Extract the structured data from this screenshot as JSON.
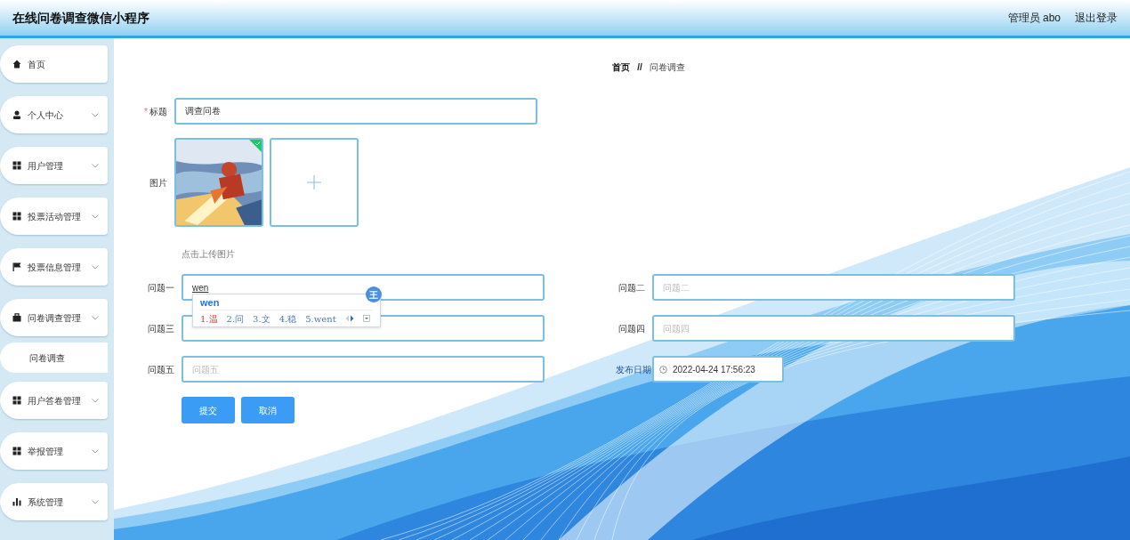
{
  "header": {
    "title": "在线问卷调查微信小程序",
    "user": "管理员 abo",
    "logout": "退出登录"
  },
  "sidebar": {
    "items": [
      {
        "label": "首页",
        "kind": "home",
        "has_submenu": false
      },
      {
        "label": "个人中心",
        "kind": "user",
        "has_submenu": true
      },
      {
        "label": "用户管理",
        "kind": "grid",
        "has_submenu": true
      },
      {
        "label": "投票活动管理",
        "kind": "grid",
        "has_submenu": true
      },
      {
        "label": "投票信息管理",
        "kind": "flag",
        "has_submenu": true
      },
      {
        "label": "问卷调查管理",
        "kind": "briefcase",
        "has_submenu": true,
        "children": [
          {
            "label": "问卷调查"
          }
        ]
      },
      {
        "label": "用户答卷管理",
        "kind": "grid",
        "has_submenu": true
      },
      {
        "label": "举报管理",
        "kind": "grid",
        "has_submenu": true
      },
      {
        "label": "系统管理",
        "kind": "chart",
        "has_submenu": true
      }
    ]
  },
  "breadcrumb": {
    "items": [
      "首页",
      "问卷调查"
    ],
    "separator": "//"
  },
  "form": {
    "title_field": {
      "label": "标题",
      "required_mark": "*",
      "value": "调查问卷"
    },
    "image": {
      "label": "图片",
      "uploaded": true,
      "hint": "点击上传图片"
    },
    "fields": [
      {
        "kind": "text",
        "label": "问题一",
        "value": "wen"
      },
      {
        "kind": "text",
        "label": "问题二",
        "placeholder": "问题二"
      },
      {
        "kind": "text",
        "label": "问题三"
      },
      {
        "kind": "text",
        "label": "问题四",
        "placeholder": "问题四"
      },
      {
        "kind": "text",
        "label": "问题五",
        "placeholder": "问题五"
      },
      {
        "kind": "date",
        "label": "发布日期",
        "value": "2022-04-24 17:56:23"
      }
    ],
    "buttons": [
      "提交",
      "取消"
    ]
  },
  "ime": {
    "composition": "wen",
    "badge": "王",
    "candidates": [
      {
        "text": "1.温",
        "selected": true
      },
      {
        "text": "2.问",
        "selected": false
      },
      {
        "text": "3.文",
        "selected": false
      },
      {
        "text": "4.稳",
        "selected": false
      },
      {
        "text": "5.went",
        "selected": false
      }
    ]
  }
}
